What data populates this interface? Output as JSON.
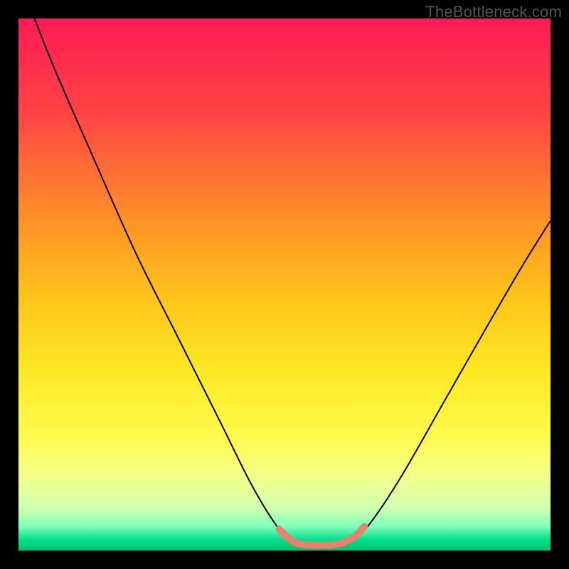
{
  "watermark": "TheBottleneck.com",
  "chart_data": {
    "type": "line",
    "title": "",
    "xlabel": "",
    "ylabel": "",
    "xlim": [
      0,
      100
    ],
    "ylim": [
      0,
      100
    ],
    "series": [
      {
        "name": "bottleneck-curve",
        "color": "#000000",
        "points": [
          {
            "x": 3,
            "y": 100
          },
          {
            "x": 7,
            "y": 90
          },
          {
            "x": 14,
            "y": 74
          },
          {
            "x": 22,
            "y": 56
          },
          {
            "x": 30,
            "y": 40
          },
          {
            "x": 38,
            "y": 24
          },
          {
            "x": 44,
            "y": 12
          },
          {
            "x": 49,
            "y": 4
          },
          {
            "x": 52,
            "y": 1.5
          },
          {
            "x": 56,
            "y": 1.0
          },
          {
            "x": 60,
            "y": 1.2
          },
          {
            "x": 63,
            "y": 2.5
          },
          {
            "x": 66,
            "y": 5
          },
          {
            "x": 72,
            "y": 14
          },
          {
            "x": 80,
            "y": 28
          },
          {
            "x": 88,
            "y": 42
          },
          {
            "x": 95,
            "y": 54
          },
          {
            "x": 100,
            "y": 62
          }
        ]
      },
      {
        "name": "optimal-zone-marker",
        "color": "#e5836f",
        "stroke_width": 10,
        "points": [
          {
            "x": 49,
            "y": 4
          },
          {
            "x": 52,
            "y": 1.5
          },
          {
            "x": 56,
            "y": 1.0
          },
          {
            "x": 60,
            "y": 1.2
          },
          {
            "x": 63,
            "y": 2.5
          },
          {
            "x": 65,
            "y": 4.5
          }
        ]
      }
    ],
    "background_gradient": {
      "stops": [
        {
          "offset": 0.0,
          "color": "#ff1a57"
        },
        {
          "offset": 0.18,
          "color": "#ff4545"
        },
        {
          "offset": 0.36,
          "color": "#ff8a2a"
        },
        {
          "offset": 0.52,
          "color": "#ffc21a"
        },
        {
          "offset": 0.66,
          "color": "#ffe824"
        },
        {
          "offset": 0.78,
          "color": "#fff94a"
        },
        {
          "offset": 0.86,
          "color": "#f4ff8a"
        },
        {
          "offset": 0.92,
          "color": "#cfffb0"
        },
        {
          "offset": 0.955,
          "color": "#7dffba"
        },
        {
          "offset": 0.98,
          "color": "#00e08a"
        },
        {
          "offset": 1.0,
          "color": "#00c074"
        }
      ]
    }
  }
}
